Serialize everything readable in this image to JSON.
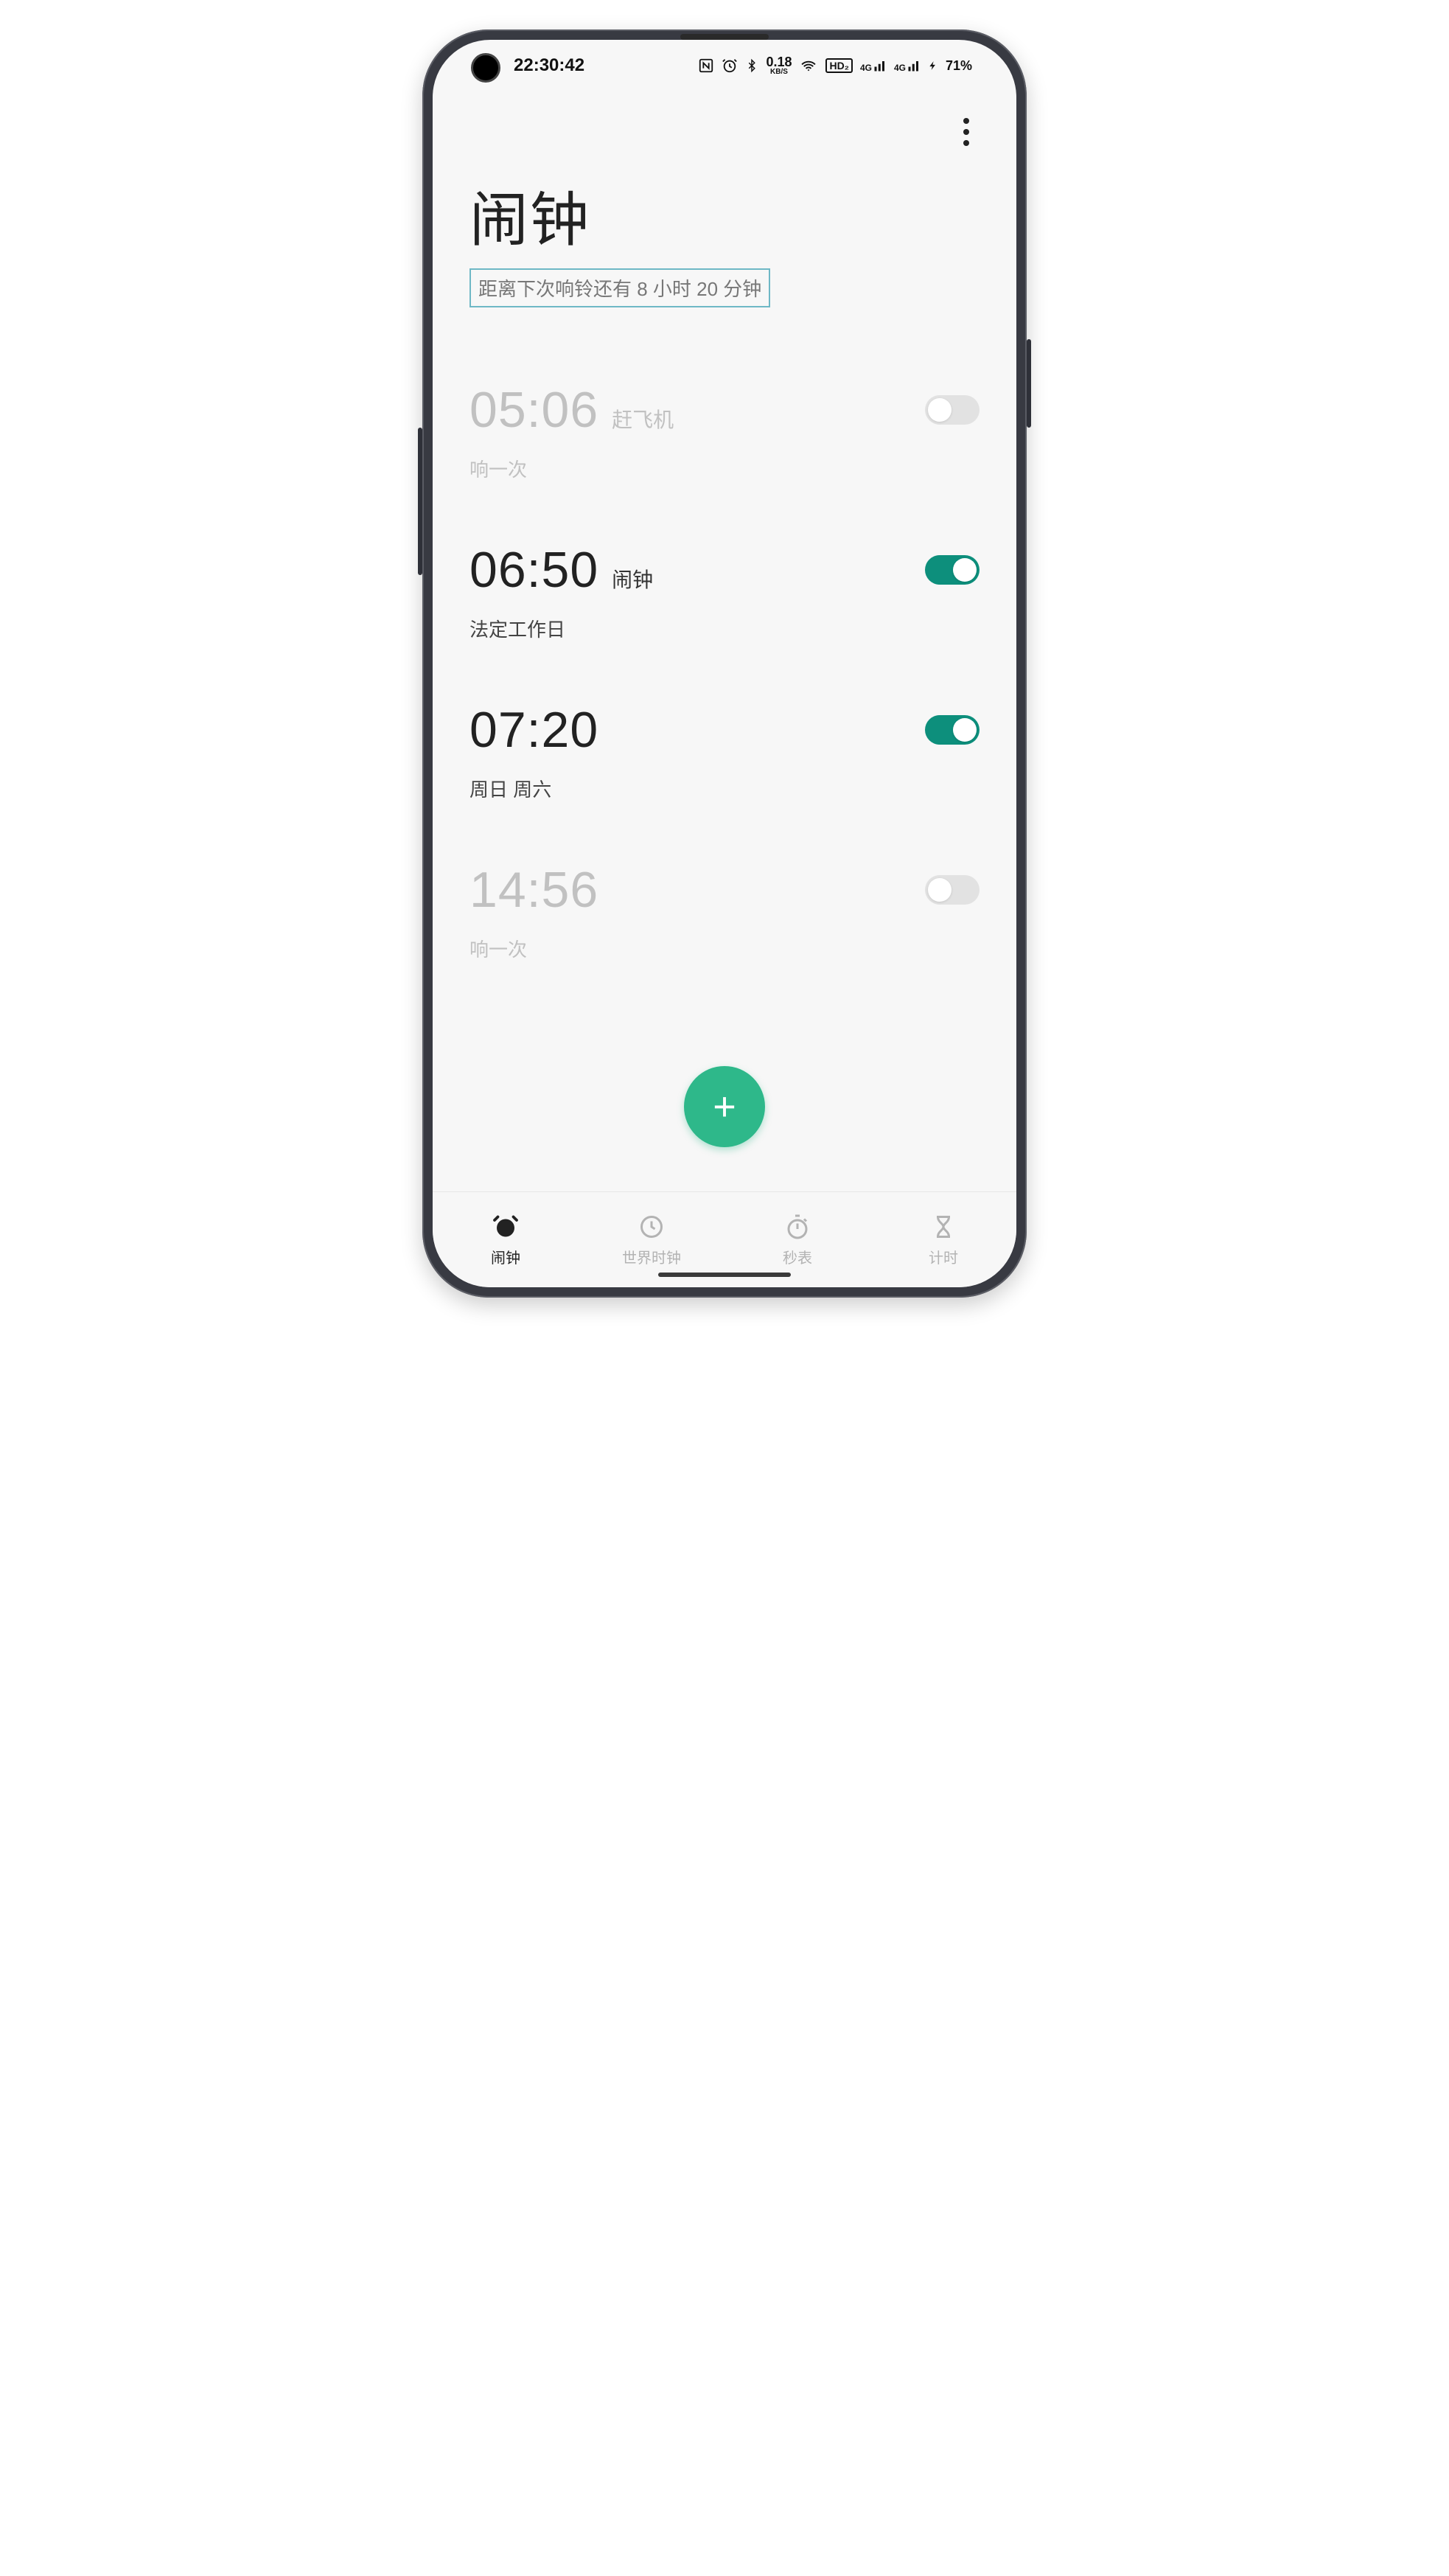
{
  "status": {
    "time": "22:30:42",
    "network_speed": "0.18",
    "network_unit": "KB/S",
    "carrier_badge": "HD₂",
    "signal1": "4G",
    "signal2": "4G",
    "battery_pct": "71%"
  },
  "header": {
    "title": "闹钟",
    "subtitle_prefix": "距离下次响铃还有",
    "subtitle_time": " 8 小时 20 分钟"
  },
  "alarms": [
    {
      "time": "05:06",
      "label": "赶飞机",
      "repeat": "响一次",
      "enabled": false
    },
    {
      "time": "06:50",
      "label": "闹钟",
      "repeat": "法定工作日",
      "enabled": true
    },
    {
      "time": "07:20",
      "label": "",
      "repeat": "周日 周六",
      "enabled": true
    },
    {
      "time": "14:56",
      "label": "",
      "repeat": "响一次",
      "enabled": false
    }
  ],
  "nav": {
    "items": [
      {
        "label": "闹钟",
        "icon": "alarm-clock-icon",
        "active": true
      },
      {
        "label": "世界时钟",
        "icon": "clock-icon",
        "active": false
      },
      {
        "label": "秒表",
        "icon": "stopwatch-icon",
        "active": false
      },
      {
        "label": "计时",
        "icon": "hourglass-icon",
        "active": false
      }
    ]
  },
  "colors": {
    "accent": "#0d8f7c",
    "fab": "#2eb88a",
    "subtitle_border": "#6eb8c6",
    "text_primary": "#222222",
    "text_disabled": "#c1c1c1",
    "bg": "#f7f7f7"
  }
}
